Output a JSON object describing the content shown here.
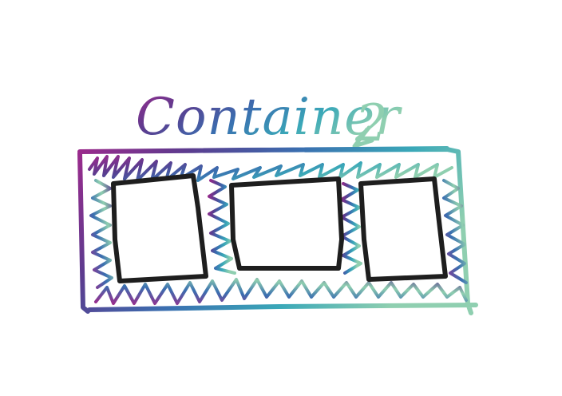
{
  "title": "Container",
  "title_suffix": "2",
  "colors": {
    "purple": "#9b2a8c",
    "violet": "#5b3c8f",
    "blue": "#3a6fb0",
    "teal": "#3aa8b8",
    "mint": "#8fcfb0",
    "box_stroke": "#1e1e1e",
    "background": "#ffffff"
  },
  "boxes": [
    {
      "label": ""
    },
    {
      "label": ""
    },
    {
      "label": ""
    }
  ]
}
